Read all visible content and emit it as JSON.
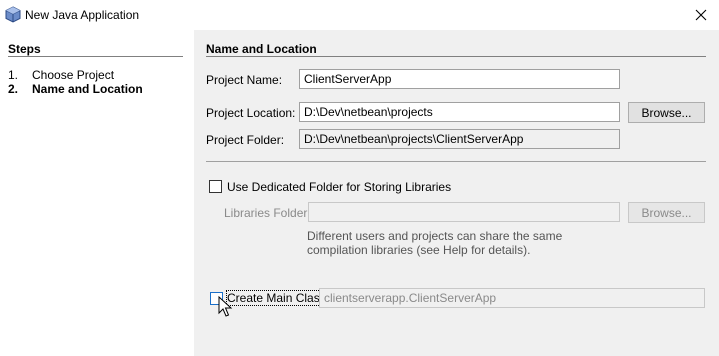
{
  "window": {
    "title": "New Java Application",
    "icon": "java-app-icon"
  },
  "steps": {
    "header": "Steps",
    "items": [
      {
        "number": "1.",
        "label": "Choose Project"
      },
      {
        "number": "2.",
        "label": "Name and Location"
      }
    ]
  },
  "form": {
    "section_title": "Name and Location",
    "project_name": {
      "label": "Project Name:",
      "value": "ClientServerApp"
    },
    "project_location": {
      "label": "Project Location:",
      "value": "D:\\Dev\\netbean\\projects",
      "browse_label": "Browse..."
    },
    "project_folder": {
      "label": "Project Folder:",
      "value": "D:\\Dev\\netbean\\projects\\ClientServerApp"
    },
    "dedicated_folder": {
      "label": "Use Dedicated Folder for Storing Libraries",
      "checked": false
    },
    "libraries_folder": {
      "label": "Libraries Folder:",
      "value": "",
      "browse_label": "Browse..."
    },
    "help_text": "Different users and projects can share the same compilation libraries (see Help for details).",
    "main_class": {
      "label": "Create Main Class",
      "checked": false,
      "value": "clientserverapp.ClientServerApp"
    }
  }
}
